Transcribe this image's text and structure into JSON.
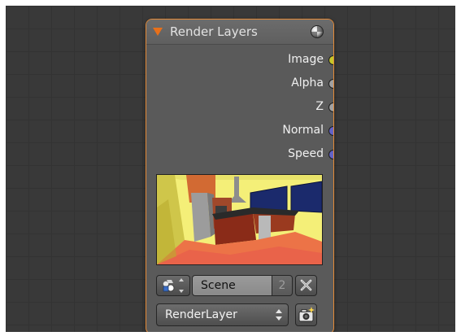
{
  "node": {
    "title": "Render Layers",
    "outputs": [
      {
        "label": "Image",
        "color": "#c7c72a"
      },
      {
        "label": "Alpha",
        "color": "#a1a1a1"
      },
      {
        "label": "Z",
        "color": "#a1a1a1"
      },
      {
        "label": "Normal",
        "color": "#6363c7"
      },
      {
        "label": "Speed",
        "color": "#6363c7"
      }
    ],
    "scene": {
      "name": "Scene",
      "users": "2"
    },
    "render_layer": "RenderLayer"
  },
  "colors": {
    "canvas": "#393939",
    "node_body": "#5a5a5a",
    "node_border_selected": "#e48a37",
    "collapse_arrow": "#e8701a"
  },
  "icons": {
    "collapse": "triangle-down-icon",
    "preview_toggle": "sphere-icon",
    "scene": "scene-icon",
    "unlink": "x-icon",
    "render": "camera-icon"
  }
}
